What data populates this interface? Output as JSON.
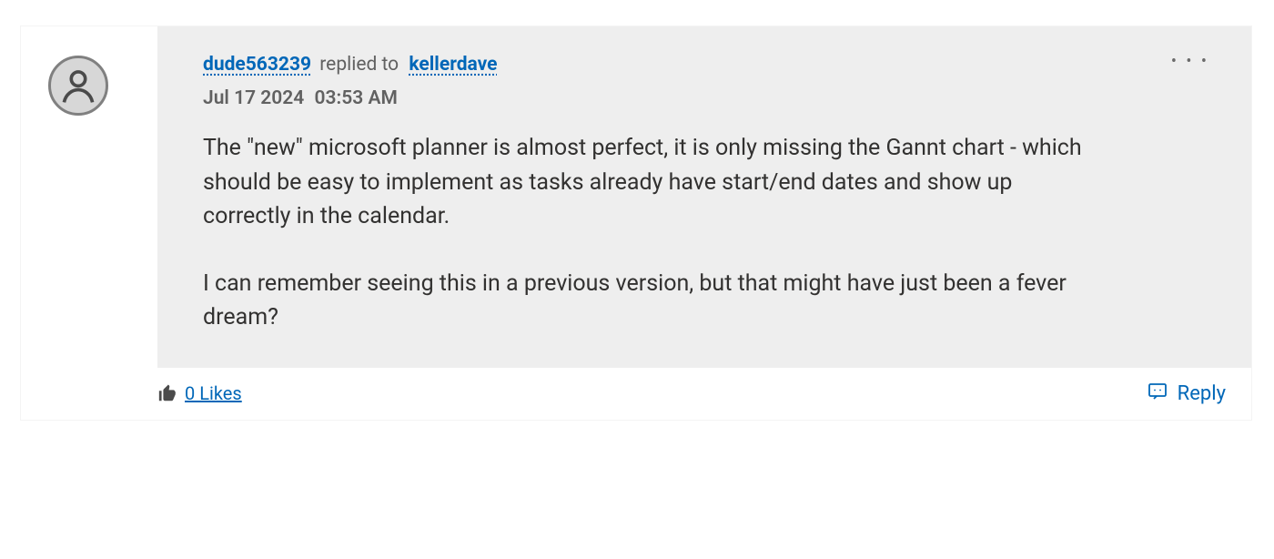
{
  "comment": {
    "author": "dude563239",
    "action_text": "replied to",
    "reply_target": "kellerdave",
    "date": "Jul 17 2024",
    "time": "03:53 AM",
    "paragraphs": [
      "The \"new\" microsoft planner is almost perfect, it is only missing the Gannt chart - which should be easy to implement as tasks already have start/end dates and show up correctly in the calendar.",
      "I can remember seeing this in a previous version, but that might have just been a fever dream?"
    ]
  },
  "footer": {
    "likes_count": 0,
    "likes_label": "0 Likes",
    "reply_label": "Reply"
  },
  "icons": {
    "more": "• • •"
  }
}
